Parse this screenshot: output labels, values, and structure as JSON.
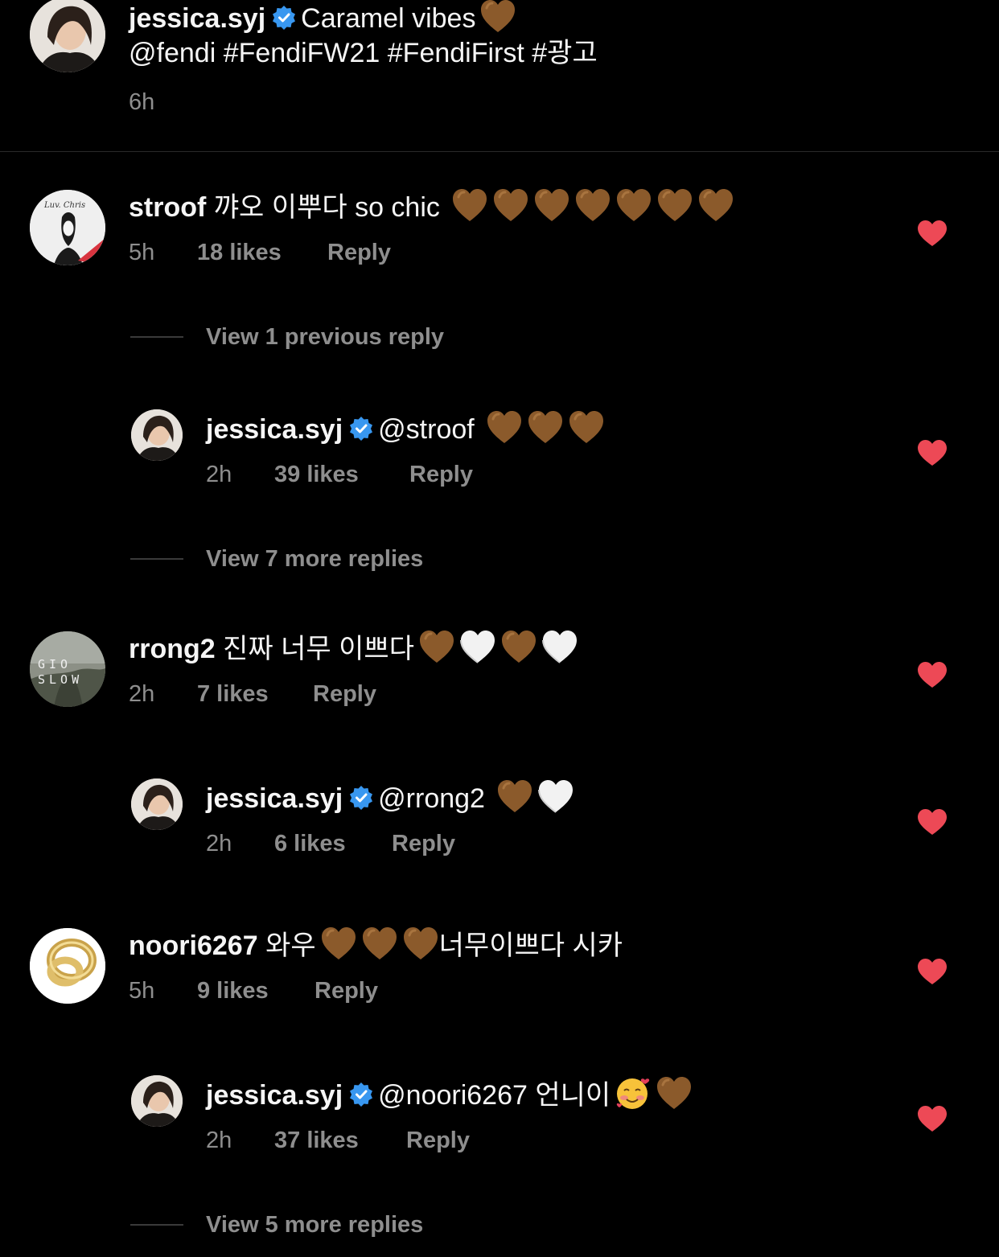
{
  "colors": {
    "background": "#000000",
    "text": "#f5f5f5",
    "muted": "#8e8e8e",
    "verified": "#3897f0",
    "like_red": "#ed4956",
    "brown_heart": "#8b5a2b",
    "white_heart": "#f2f2f2"
  },
  "post": {
    "username": "jessica.syj",
    "caption": "Caramel vibes",
    "caption_emoji": "brown-heart",
    "tags": "@fendi #FendiFW21 #FendiFirst #광고",
    "time": "6h"
  },
  "comments": [
    {
      "username": "stroof",
      "text": "꺄오 이뿌다 so chic",
      "emojis": [
        "brown-heart",
        "brown-heart",
        "brown-heart",
        "brown-heart",
        "brown-heart",
        "brown-heart",
        "brown-heart"
      ],
      "time": "5h",
      "likes": "18 likes",
      "reply": "Reply",
      "view_previous": "View 1 previous reply",
      "replies": [
        {
          "username": "jessica.syj",
          "text": "@stroof",
          "emojis": [
            "brown-heart",
            "brown-heart",
            "brown-heart"
          ],
          "time": "2h",
          "likes": "39 likes",
          "reply": "Reply"
        }
      ],
      "view_more": "View 7 more replies"
    },
    {
      "username": "rrong2",
      "text": "진짜 너무 이쁘다",
      "emojis": [
        "brown-heart",
        "white-heart",
        "brown-heart",
        "white-heart"
      ],
      "time": "2h",
      "likes": "7 likes",
      "reply": "Reply",
      "replies": [
        {
          "username": "jessica.syj",
          "text": "@rrong2",
          "emojis": [
            "brown-heart",
            "white-heart"
          ],
          "time": "2h",
          "likes": "6 likes",
          "reply": "Reply"
        }
      ]
    },
    {
      "username": "noori6267",
      "text": "와우",
      "emojis": [
        "brown-heart",
        "brown-heart",
        "brown-heart"
      ],
      "text_after": "너무이쁘다 시카",
      "time": "5h",
      "likes": "9 likes",
      "reply": "Reply",
      "replies": [
        {
          "username": "jessica.syj",
          "text": "@noori6267 언니이",
          "emojis": [
            "smiling-face-with-hearts",
            "brown-heart"
          ],
          "time": "2h",
          "likes": "37 likes",
          "reply": "Reply"
        }
      ],
      "view_more": "View 5 more replies"
    }
  ],
  "avatars": {
    "stroof_sign": "Luv. Chris",
    "rrong2_sign": "GIO SLOW"
  }
}
